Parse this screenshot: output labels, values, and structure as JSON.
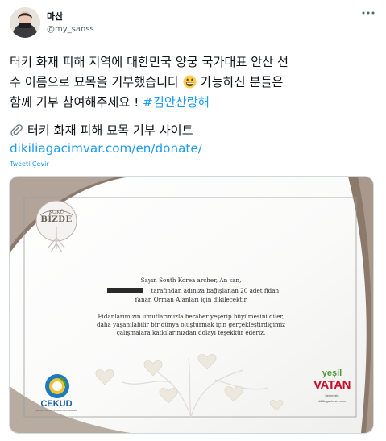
{
  "author": {
    "display_name": "마산",
    "handle": "@my_sanss"
  },
  "more_icon": "more-horizontal-icon",
  "tweet": {
    "lines": [
      "터키 화재 피해 지역에 대한민국 양궁 국가대표 안산 선",
      "수 이름으로 묘목을 기부했습니다",
      "가능하신 분들은",
      "함께 기부 참여해주세요 ! ",
      "#김안산랑해"
    ],
    "emoji": "grinning-face-emoji",
    "link_prefix_icon": "paperclip-icon",
    "link_caption": "터키 화재 피해 묘목 기부 사이트",
    "link_url": "dikiliagacimvar.com/en/donate/",
    "translate_label": "Tweeti Çevir"
  },
  "certificate": {
    "logo_top": "KOKÜ",
    "logo_brand": "BİZDE",
    "salutation": "Sayın South Korea archer, An san,",
    "body_line1": "tarafından adınıza bağışlanan 20 adet fidan,",
    "body_line2": "Yanan Orman Alanları için dikilecektir.",
    "para_line1": "Fidanlarımızın umutlarımızla beraber yeşerip büyümesini diler,",
    "para_line2": "daha yaşanılabilir bir dünya oluşturmak için gerçekleştirdiğimiz",
    "para_line3": "çalışmalara katkılarınızdan dolayı teşekkür ederiz.",
    "left_logo": "CEKUD",
    "left_logo_sub": "ÇEVRE KORUMA VE ARAŞTIRMA DERNEĞİ",
    "right_logo_top": "yeşil",
    "right_logo_brand": "VATAN",
    "right_logo_sub": "hepimizin",
    "right_logo_url": "dikiliagacimvar.com",
    "colors": {
      "frame_brown": "#8b7a6b",
      "vatan_red": "#c8102e",
      "yesil_green": "#4a9a3a",
      "cekud_blue": "#1a7bbf",
      "cekud_yellow": "#f2c230"
    }
  }
}
